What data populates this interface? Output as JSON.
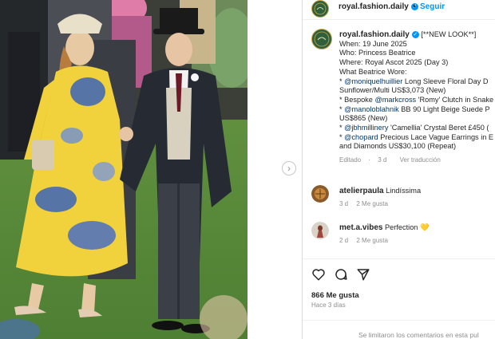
{
  "post_header": {
    "username": "royal.fashion.daily",
    "dot": "•",
    "follow_label": "Seguir"
  },
  "caption": {
    "username": "royal.fashion.daily",
    "title": "[**NEW LOOK**]",
    "lines": {
      "when": "When: 19 June 2025",
      "who": "Who: Princess Beatrice",
      "where": "Where: Royal Ascot 2025 (Day 3)",
      "what": "What Beatrice Wore:"
    },
    "items": {
      "item1_prefix": "* ",
      "item1_mention": "@moniquelhuillier",
      "item1_text": " Long Sleeve Floral Day D",
      "item1_text2": "Sunflower/Multi US$3,073 (New)",
      "item2_prefix": "* Bespoke ",
      "item2_mention": "@markcross",
      "item2_text": " 'Romy' Clutch in Snake",
      "item3_prefix": "* ",
      "item3_mention": "@manoloblahnik",
      "item3_text": " BB 90 Light Beige Suede P",
      "item3_text2": "US$865 (New)",
      "item4_prefix": "* ",
      "item4_mention": "@jbhmillinery",
      "item4_text": " 'Camellia' Crystal Beret £450 (",
      "item5_prefix": "* ",
      "item5_mention": "@chopard",
      "item5_text": " Precious Lace Vague Earrings in E",
      "item5_text2": "and Diamonds US$30,100 (Repeat)"
    },
    "meta": {
      "edited": "Editado",
      "dot": "·",
      "time": "3 d",
      "translate": "Ver traducción"
    }
  },
  "comments": [
    {
      "username": "atelierpaula",
      "text": "Lindíssima",
      "time": "3 d",
      "likes": "2 Me gusta"
    },
    {
      "username": "met.a.vibes",
      "text": "Perfection",
      "emoji": "💛",
      "time": "2 d",
      "likes": "2 Me gusta"
    }
  ],
  "engagement": {
    "likes_count": "866 Me gusta",
    "posted_ago": "Hace 3 días"
  },
  "footer": {
    "comments_disabled": "Se limitaron los comentarios en esta pul"
  },
  "icons": {
    "next": "chevron-right-icon",
    "like": "heart-icon",
    "comment": "comment-bubble-icon",
    "share": "paper-plane-icon"
  },
  "colors": {
    "link": "#0095f6",
    "mention": "#00376b",
    "muted": "#8e8e8e",
    "text": "#262626",
    "dress_yellow": "#f2d23c",
    "grass": "#5f8f3e"
  }
}
